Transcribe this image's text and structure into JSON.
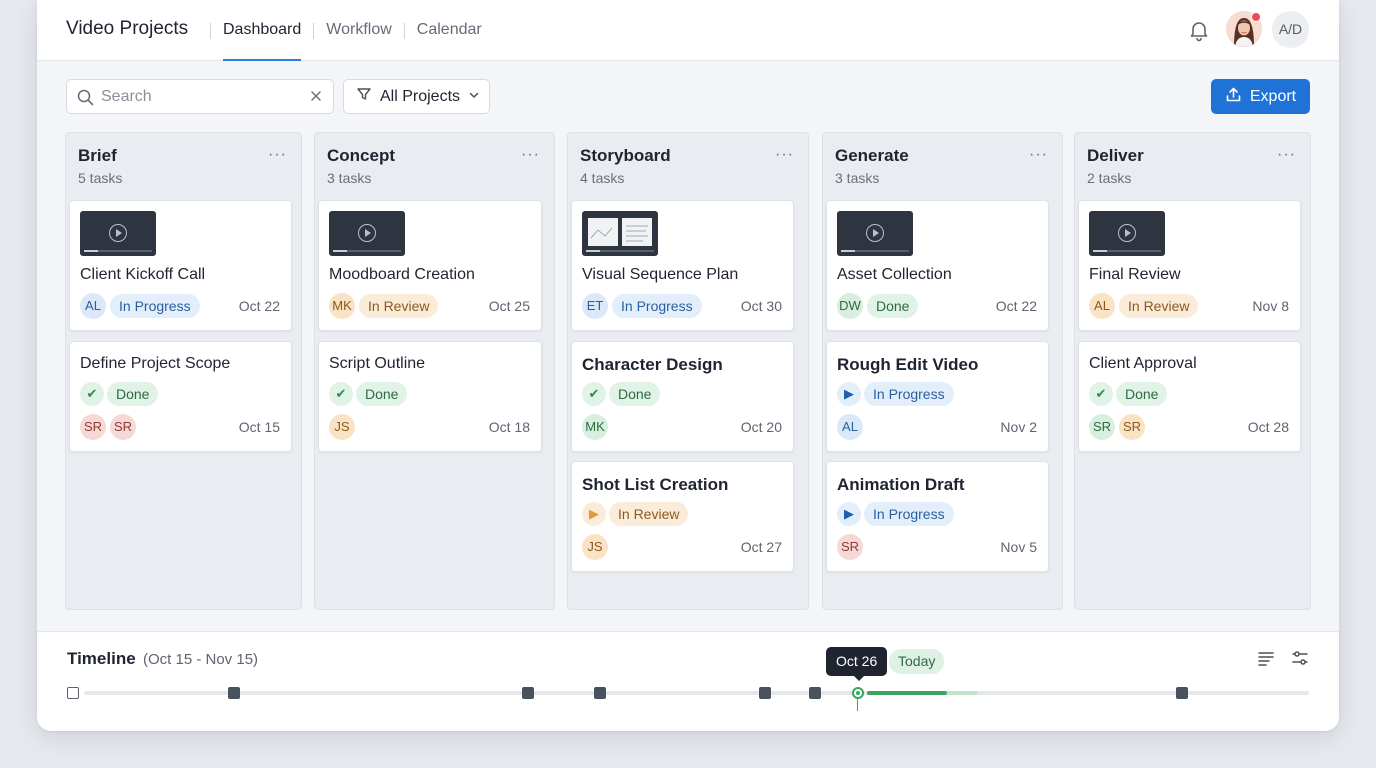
{
  "header": {
    "app_title": "Video Projects",
    "tabs": [
      {
        "label": "Dashboard",
        "active": true
      },
      {
        "label": "Workflow",
        "active": false
      },
      {
        "label": "Calendar",
        "active": false
      }
    ],
    "user_initials": "A/D",
    "notification_icon": "bell-icon"
  },
  "toolbar": {
    "search_placeholder": "Search",
    "filter_label": "All Projects",
    "export_label": "Export"
  },
  "columns": [
    {
      "title": "Brief",
      "count": "5 tasks",
      "cards": [
        {
          "title": "Client Kickoff Call",
          "status": "In Progress",
          "assignees": [
            "AL"
          ],
          "date": "Oct 22"
        },
        {
          "title": "Define Project Scope",
          "status": "Done",
          "assignees": [
            "SR",
            "SR"
          ],
          "date": "Oct 15"
        }
      ]
    },
    {
      "title": "Concept",
      "count": "3 tasks",
      "cards": [
        {
          "title": "Moodboard Creation",
          "status": "In Review",
          "assignees": [
            "MK"
          ],
          "date": "Oct 25"
        },
        {
          "title": "Script Outline",
          "status": "Done",
          "assignees": [
            "JS"
          ],
          "date": "Oct 18"
        }
      ]
    },
    {
      "title": "Storyboard",
      "count": "4 tasks",
      "cards": [
        {
          "title": "Visual Sequence Plan",
          "status": "In Progress",
          "assignees": [
            "ET"
          ],
          "date": "Oct 30"
        },
        {
          "title": "Character Design",
          "status": "Done",
          "assignees": [
            "MK"
          ],
          "date": "Oct 20"
        },
        {
          "title": "Shot List Creation",
          "status": "In Review",
          "assignees": [
            "JS"
          ],
          "date": "Oct 27"
        }
      ]
    },
    {
      "title": "Generate",
      "count": "3 tasks",
      "cards": [
        {
          "title": "Asset Collection",
          "status": "Done",
          "assignees": [
            "DW"
          ],
          "date": "Oct 22"
        },
        {
          "title": "Rough Edit Video",
          "status": "In Progress",
          "assignees": [
            "AL"
          ],
          "date": "Nov 2"
        },
        {
          "title": "Animation Draft",
          "status": "In Progress",
          "assignees": [
            "SR"
          ],
          "date": "Nov 5"
        }
      ]
    },
    {
      "title": "Deliver",
      "count": "2 tasks",
      "cards": [
        {
          "title": "Final Review",
          "status": "In Review",
          "assignees": [
            "AL"
          ],
          "date": "Nov 8"
        },
        {
          "title": "Client Approval",
          "status": "Done",
          "assignees": [
            "SR",
            "SR"
          ],
          "date": "Oct 28"
        }
      ]
    }
  ],
  "timeline": {
    "title": "Timeline",
    "range": "(Oct 15 - Nov 15)",
    "tooltip": "Oct 26",
    "today_label": "Today"
  },
  "colors": {
    "accent": "#1f73d6",
    "done": "#2f8a4d",
    "in_progress": "#2a5f9e",
    "in_review": "#8a5a1c"
  }
}
